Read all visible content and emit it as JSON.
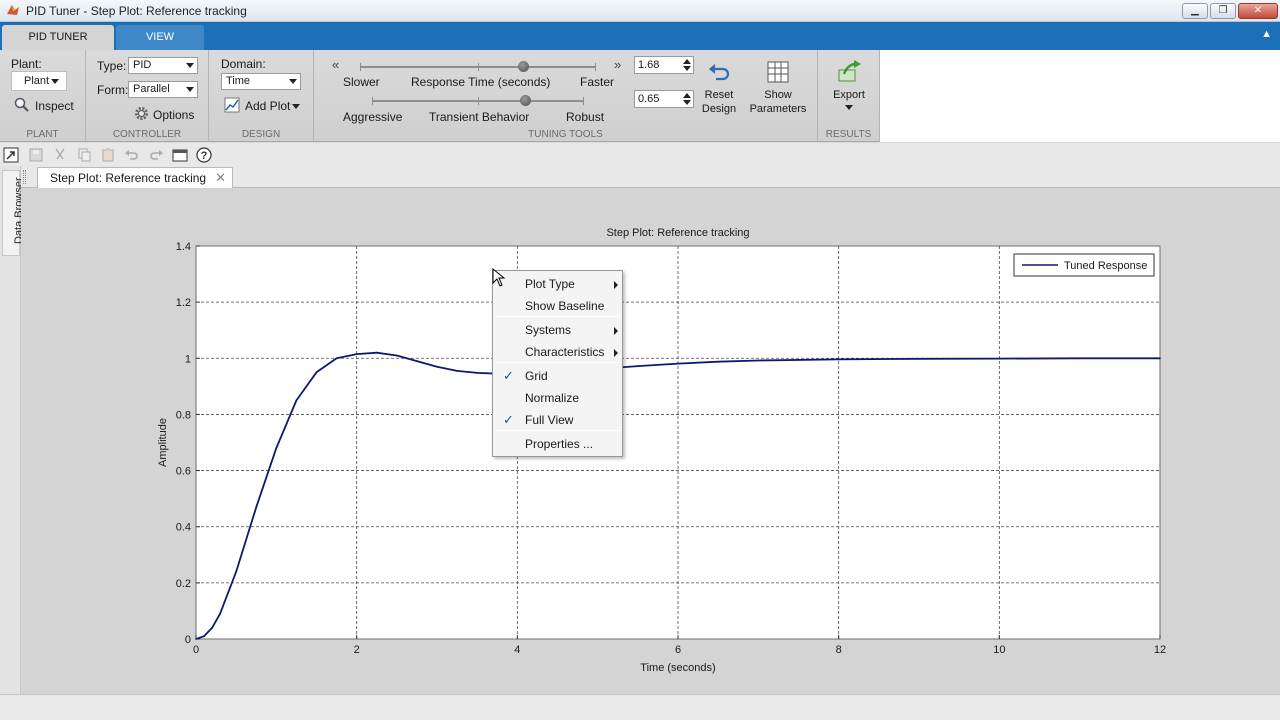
{
  "window": {
    "title": "PID Tuner - Step Plot: Reference tracking",
    "controls": [
      "minimize",
      "restore",
      "close"
    ]
  },
  "ribbon_tabs": [
    {
      "label": "PID TUNER",
      "active": true
    },
    {
      "label": "VIEW",
      "active": false
    }
  ],
  "ribbon": {
    "plant": {
      "label": "Plant:",
      "value": "Plant",
      "inspect": "Inspect",
      "group": "PLANT"
    },
    "controller": {
      "type_label": "Type:",
      "type_value": "PID",
      "form_label": "Form:",
      "form_value": "Parallel",
      "options": "Options",
      "group": "CONTROLLER"
    },
    "design": {
      "domain_label": "Domain:",
      "domain_value": "Time",
      "add_plot": "Add Plot",
      "group": "DESIGN"
    },
    "tuning": {
      "slider1": {
        "left": "Slower",
        "center": "Response Time (seconds)",
        "right": "Faster",
        "value": "1.68",
        "position": 0.69
      },
      "slider2": {
        "left": "Aggressive",
        "center": "Transient Behavior",
        "right": "Robust",
        "value": "0.65",
        "position": 0.72
      },
      "reset": [
        "Reset",
        "Design"
      ],
      "show": [
        "Show",
        "Parameters"
      ],
      "group": "TUNING TOOLS"
    },
    "results": {
      "export": "Export",
      "group": "RESULTS"
    }
  },
  "side_panel": {
    "label": "Data Browser"
  },
  "document_tab": {
    "label": "Step Plot: Reference tracking"
  },
  "chart_data": {
    "type": "line",
    "title": "Step Plot: Reference tracking",
    "xlabel": "Time (seconds)",
    "ylabel": "Amplitude",
    "xlim": [
      0,
      12
    ],
    "ylim": [
      0,
      1.4
    ],
    "xticks": [
      0,
      2,
      4,
      6,
      8,
      10,
      12
    ],
    "yticks": [
      0,
      0.2,
      0.4,
      0.6,
      0.8,
      1,
      1.2,
      1.4
    ],
    "ytick_labels": [
      "0",
      "0.2",
      "0.4",
      "0.6",
      "0.8",
      "1",
      "1.2",
      "1.4"
    ],
    "grid": true,
    "legend": {
      "position": "top-right",
      "entries": [
        "Tuned Response"
      ]
    },
    "series": [
      {
        "name": "Tuned Response",
        "color": "#0b1a6e",
        "x": [
          0,
          0.1,
          0.2,
          0.3,
          0.5,
          0.75,
          1.0,
          1.25,
          1.5,
          1.75,
          2.0,
          2.25,
          2.5,
          2.75,
          3.0,
          3.25,
          3.5,
          3.75,
          4.0,
          4.5,
          5.0,
          5.5,
          6.0,
          6.5,
          7.0,
          8.0,
          9.0,
          10.0,
          11.0,
          12.0
        ],
        "y": [
          0,
          0.01,
          0.04,
          0.09,
          0.24,
          0.47,
          0.68,
          0.85,
          0.95,
          1.0,
          1.015,
          1.02,
          1.01,
          0.99,
          0.97,
          0.955,
          0.948,
          0.945,
          0.945,
          0.952,
          0.962,
          0.972,
          0.981,
          0.988,
          0.992,
          0.996,
          0.998,
          0.999,
          1.0,
          1.0
        ]
      }
    ]
  },
  "context_menu": {
    "items": [
      {
        "label": "Plot Type",
        "submenu": true,
        "checked": false
      },
      {
        "label": "Show Baseline",
        "submenu": false,
        "checked": false
      },
      {
        "label": "Systems",
        "submenu": true,
        "checked": false
      },
      {
        "label": "Characteristics",
        "submenu": true,
        "checked": false
      },
      {
        "label": "Grid",
        "submenu": false,
        "checked": true
      },
      {
        "label": "Normalize",
        "submenu": false,
        "checked": false
      },
      {
        "label": "Full View",
        "submenu": false,
        "checked": true
      },
      {
        "label": "Properties ...",
        "submenu": false,
        "checked": false
      }
    ]
  },
  "colors": {
    "ribbon_blue": "#1d6fb8",
    "line": "#0b1a6e",
    "figure_bg": "#d4d4d4"
  }
}
